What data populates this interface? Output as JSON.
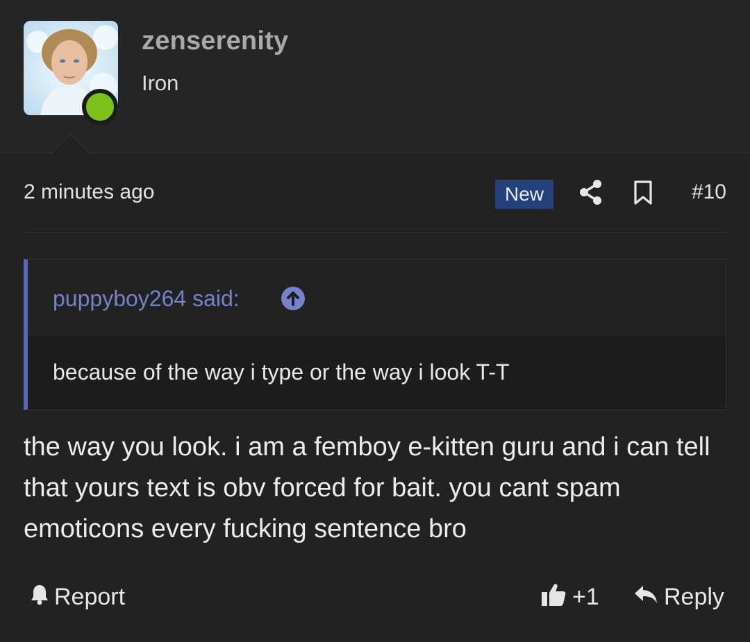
{
  "user": {
    "username": "zenserenity",
    "rank": "Iron",
    "online": true,
    "online_color": "#7cc21a"
  },
  "post": {
    "timestamp": "2 minutes ago",
    "badge": "New",
    "badge_color": "#25407a",
    "number": "#10",
    "icons": [
      "share-icon",
      "bookmark-icon"
    ]
  },
  "quote": {
    "author_line": "puppyboy264 said:",
    "jump_icon": "arrow-up-circle-icon",
    "body": "because of the way i type or the way i look T-T",
    "accent_color": "#5865b8"
  },
  "message": {
    "text": "the way you look. i am a femboy e-kitten guru and i can tell that yours text is obv forced for bait. you cant spam emoticons every fucking sentence bro"
  },
  "actions": {
    "report_label": "Report",
    "like_count": "+1",
    "reply_label": "Reply"
  }
}
